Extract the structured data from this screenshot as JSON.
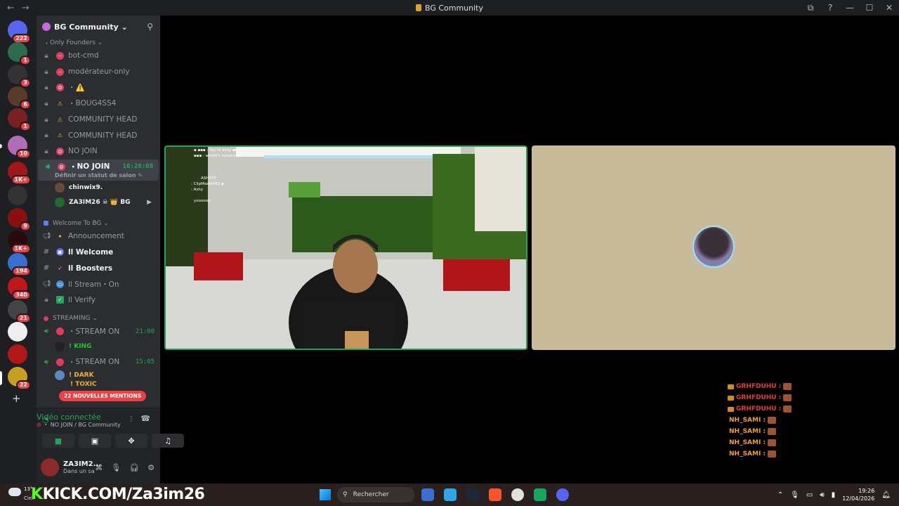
{
  "window": {
    "title": "BG Community",
    "nav_back": "←",
    "nav_forward": "→"
  },
  "rail": {
    "badges": [
      "222",
      "1",
      "3",
      "6",
      "1",
      "10",
      "1K+",
      "9",
      "1K+",
      "194",
      "340",
      "21",
      "22"
    ]
  },
  "server": {
    "name": "BG Community ⌄",
    "category_only_founders": "Only Founders",
    "channels": [
      {
        "label": "bot-cmd",
        "emoji": "none"
      },
      {
        "label": "modérateur-only",
        "emoji": "none"
      },
      {
        "label": "⚠️",
        "emoji": "ban"
      },
      {
        "label": "BOUG4SS4",
        "emoji": "warn"
      },
      {
        "label": "COMMUNITY HEAD",
        "emoji": "warn"
      },
      {
        "label": "COMMUNITY HEAD",
        "emoji": "warn"
      },
      {
        "label": "NO JOIN",
        "emoji": "ban"
      }
    ],
    "active_voice": {
      "label": "NO JOIN",
      "time": "10:26:08",
      "status": "Définir un statut de salon ✎"
    },
    "voice_users": [
      {
        "name": "chinwix9."
      },
      {
        "name": "ZA3IM26 ☠ 👑 BG"
      }
    ],
    "category_welcome": "Welcome To BG",
    "welcome_channels": [
      {
        "label": "Announcement",
        "icon": "megaphone-icon"
      },
      {
        "label": "ll Welcome",
        "icon": "hash-icon"
      },
      {
        "label": "ll Boosters",
        "icon": "hash-icon"
      },
      {
        "label": "ll Stream・On",
        "icon": "megaphone-icon"
      },
      {
        "label": "ll Verify",
        "icon": "lock-icon"
      }
    ],
    "category_streaming": "STREAMING",
    "streaming": [
      {
        "label": "STREAM ON",
        "time": "21:00",
        "user": "! KING"
      },
      {
        "label": "STREAM ON",
        "time": "15:05",
        "user": "! DARK"
      }
    ],
    "partial_user": "! TOXIC",
    "mentions_pill": "22 NOUVELLES MENTIONS"
  },
  "voice_panel": {
    "title": "Vidéo connectée",
    "subtitle": "NO JOIN / BG Community"
  },
  "user_panel": {
    "name": "ZA3IM2...",
    "status": "Dans un sa"
  },
  "chat_overlay": [
    {
      "name": "GRHFDUHU :",
      "color": "#e23b3b"
    },
    {
      "name": "GRHFDUHU :",
      "color": "#e23b3b"
    },
    {
      "name": "GRHFDUHU :",
      "color": "#e23b3b"
    },
    {
      "name": "NH_SAMI :",
      "color": "#f0a020"
    },
    {
      "name": "NH_SAMI :",
      "color": "#f0a020"
    },
    {
      "name": "NH_SAMI :",
      "color": "#f0a020"
    },
    {
      "name": "NH_SAMI :",
      "color": "#f0a020"
    }
  ],
  "taskbar": {
    "kick_prefix": "K",
    "kick_text": "KICK.COM/Za3im26",
    "weather_temp": "13°",
    "weather_label": "Ciel",
    "search_placeholder": "Rechercher",
    "time": "19:26",
    "date": "12/04/2026"
  }
}
